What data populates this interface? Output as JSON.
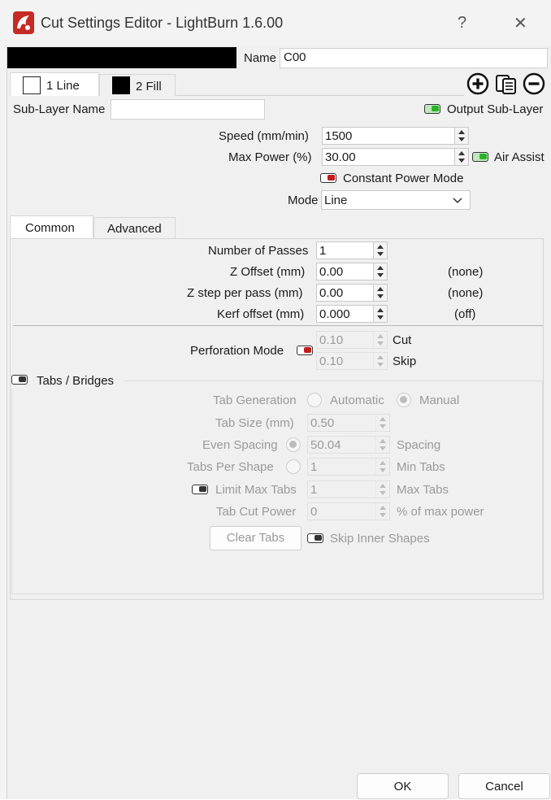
{
  "window": {
    "title": "Cut Settings Editor - LightBurn 1.6.00",
    "help_label": "?",
    "close_label": "✕"
  },
  "colors": {
    "accent_on": "#2ab32a",
    "accent_off": "#c41a1a",
    "panel": "#f0f0f0"
  },
  "header": {
    "name_label": "Name",
    "name_value": "C00"
  },
  "sublayer_tabs": [
    {
      "label": "1 Line",
      "swatch": "#ffffff"
    },
    {
      "label": "2 Fill",
      "swatch": "#000000"
    }
  ],
  "sublayer": {
    "name_label": "Sub-Layer Name",
    "name_value": "",
    "output_label": "Output Sub-Layer"
  },
  "settings": {
    "speed_label": "Speed (mm/min)",
    "speed_value": "1500",
    "max_power_label": "Max Power (%)",
    "max_power_value": "30.00",
    "air_assist_label": "Air Assist",
    "constant_power_label": "Constant Power Mode",
    "mode_label": "Mode",
    "mode_value": "Line"
  },
  "tabs": [
    {
      "label": "Common"
    },
    {
      "label": "Advanced"
    }
  ],
  "common": {
    "passes_label": "Number of Passes",
    "passes_value": "1",
    "z_offset_label": "Z Offset (mm)",
    "z_offset_value": "0.00",
    "z_offset_note": "(none)",
    "z_step_label": "Z step per pass (mm)",
    "z_step_value": "0.00",
    "z_step_note": "(none)",
    "kerf_label": "Kerf offset (mm)",
    "kerf_value": "0.000",
    "kerf_note": "(off)",
    "perforation_label": "Perforation Mode",
    "perf_cut_value": "0.10",
    "perf_cut_label": "Cut",
    "perf_skip_value": "0.10",
    "perf_skip_label": "Skip"
  },
  "tabs_bridges": {
    "label": "Tabs / Bridges",
    "generation_label": "Tab Generation",
    "automatic_label": "Automatic",
    "manual_label": "Manual",
    "size_label": "Tab Size (mm)",
    "size_value": "0.50",
    "even_spacing_label": "Even Spacing",
    "even_spacing_value": "50.04",
    "spacing_label": "Spacing",
    "per_shape_label": "Tabs Per Shape",
    "per_shape_value": "1",
    "min_tabs_label": "Min Tabs",
    "limit_max_label": "Limit Max Tabs",
    "limit_max_value": "1",
    "max_tabs_label": "Max Tabs",
    "cut_power_label": "Tab Cut Power",
    "cut_power_value": "0",
    "cut_power_unit": "% of max power",
    "clear_label": "Clear Tabs",
    "skip_inner_label": "Skip Inner Shapes"
  },
  "footer": {
    "ok_label": "OK",
    "cancel_label": "Cancel"
  }
}
